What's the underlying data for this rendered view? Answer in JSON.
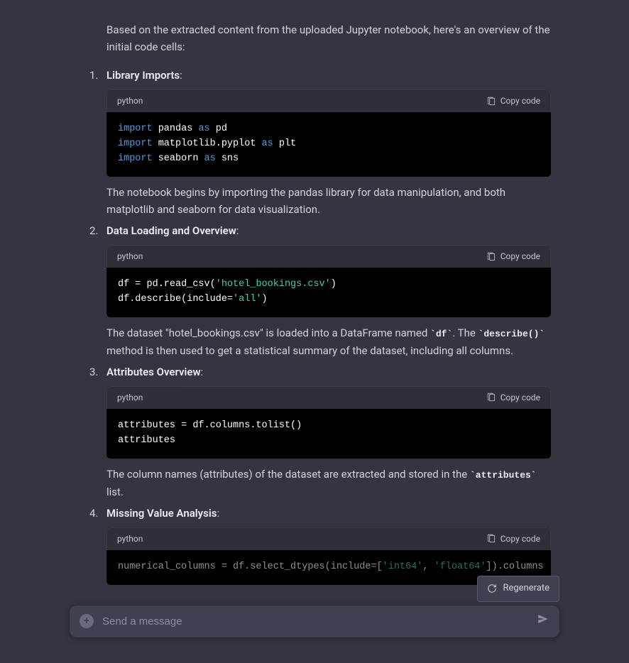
{
  "intro": "Based on the extracted content from the uploaded Jupyter notebook, here's an overview of the initial code cells:",
  "copy_label": "Copy code",
  "lang_label": "python",
  "items": [
    {
      "title": "Library Imports",
      "desc_before": "",
      "desc_after": "The notebook begins by importing the pandas library for data manipulation, and both matplotlib and seaborn for data visualization."
    },
    {
      "title": "Data Loading and Overview",
      "desc_after_pre": "The dataset \"hotel_bookings.csv\" is loaded into a DataFrame named ",
      "desc_after_code1": "`df`",
      "desc_after_mid": ". The ",
      "desc_after_code2": "`describe()`",
      "desc_after_post": " method is then used to get a statistical summary of the dataset, including all columns."
    },
    {
      "title": "Attributes Overview",
      "desc_after_pre": "The column names (attributes) of the dataset are extracted and stored in the ",
      "desc_after_code1": "`attributes`",
      "desc_after_post": " list."
    },
    {
      "title": "Missing Value Analysis"
    }
  ],
  "code": {
    "c1": {
      "l1_kw": "import",
      "l1_id": " pandas ",
      "l1_as": "as",
      "l1_al": " pd",
      "l2_kw": "import",
      "l2_id": " matplotlib.pyplot ",
      "l2_as": "as",
      "l2_al": " plt",
      "l3_kw": "import",
      "l3_id": " seaborn ",
      "l3_as": "as",
      "l3_al": " sns"
    },
    "c2": {
      "l1_a": "df = pd.read_csv(",
      "l1_s": "'hotel_bookings.csv'",
      "l1_b": ")",
      "l2_a": "df.describe(include=",
      "l2_s": "'all'",
      "l2_b": ")"
    },
    "c3": {
      "l1": "attributes = df.columns.tolist()",
      "l2": "attributes"
    },
    "c4": {
      "l1_a": "numerical_columns = df.select_dtypes(include=[",
      "l1_s1": "'int64'",
      "l1_c": ", ",
      "l1_s2": "'float64'",
      "l1_b": "]).columns"
    }
  },
  "regenerate_label": "Regenerate",
  "input_placeholder": "Send a message"
}
